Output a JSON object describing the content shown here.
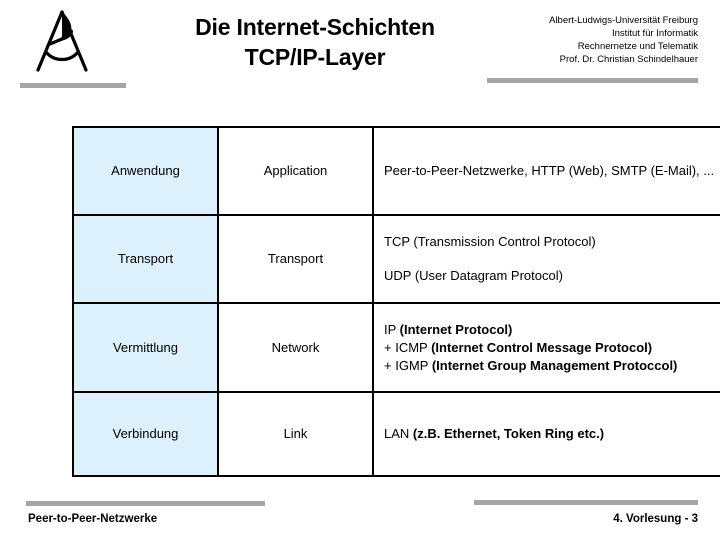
{
  "header": {
    "logo_icon": "university-seal-a-icon",
    "title_lines": [
      "Die Internet-Schichten",
      "TCP/IP-Layer"
    ],
    "affiliation_lines": [
      "Albert-Ludwigs-Universität Freiburg",
      "Institut für Informatik",
      "Rechnernetze und Telematik",
      "Prof. Dr. Christian Schindelhauer"
    ],
    "rule_color": "#a6a6a6"
  },
  "table": {
    "highlight_color": "#ddf1fd",
    "border_color": "#000000",
    "rows": [
      {
        "german": "Anwendung",
        "english": "Application",
        "description": [
          {
            "text": "Peer-to-Peer-Netzwerke, HTTP (Web), SMTP (E-Mail), ...",
            "bold": false,
            "spaced": false
          }
        ]
      },
      {
        "german": "Transport",
        "english": "Transport",
        "description": [
          {
            "text": "TCP (Transmission Control Protocol)",
            "bold": false,
            "spaced": true
          },
          {
            "text": "UDP (User Datagram Protocol)",
            "bold": false,
            "spaced": false
          }
        ]
      },
      {
        "german": "Vermittlung",
        "english": "Network",
        "description": [
          {
            "plain": "IP ",
            "bold_text": "(Internet Protocol)"
          },
          {
            "plain": "+ ICMP ",
            "bold_text": "(Internet Control Message Protocol)"
          },
          {
            "plain": "+ IGMP ",
            "bold_text": "(Internet  Group Management Protoccol)"
          }
        ]
      },
      {
        "german": "Verbindung",
        "english": "Link",
        "description": [
          {
            "plain": "LAN ",
            "bold_text": "(z.B. Ethernet, Token Ring etc.)"
          }
        ]
      }
    ]
  },
  "footer": {
    "left_label": "Peer-to-Peer-Netzwerke",
    "right_label": "4. Vorlesung - 3",
    "rule_color": "#a6a6a6"
  }
}
